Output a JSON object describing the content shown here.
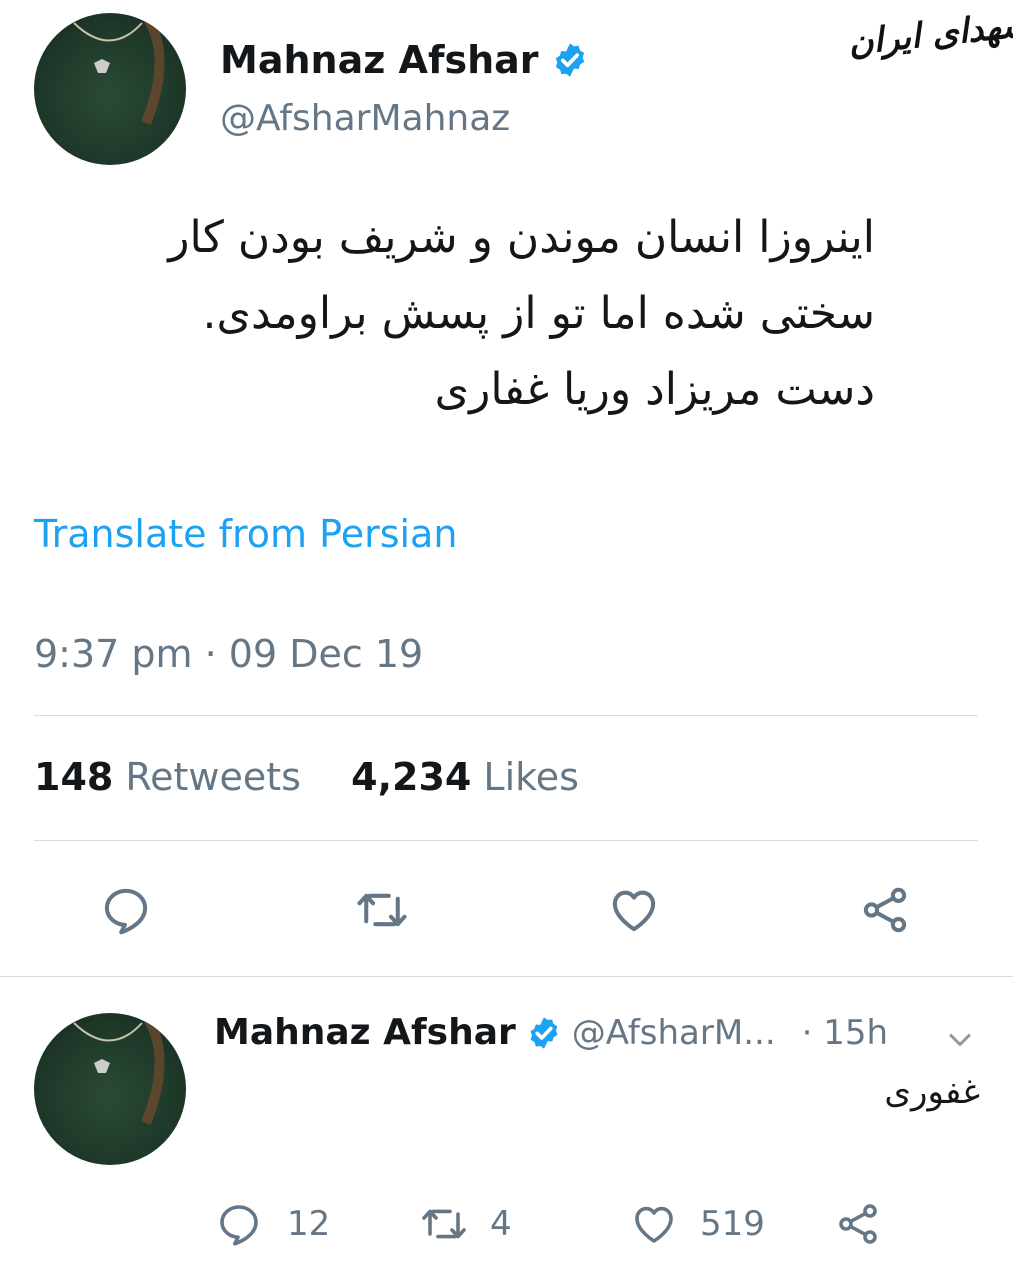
{
  "watermark": "شهدای ایران",
  "tweet": {
    "author_name": "Mahnaz Afshar",
    "author_handle": "@AfsharMahnaz",
    "text_lines": [
      "اینروزا انسان موندن و شریف بودن کار",
      "سختی شده اما تو از پسش براومدی.",
      "دست مریزاد وریا غفاری"
    ],
    "translate_label": "Translate from Persian",
    "timestamp": "9:37 pm · 09 Dec 19",
    "retweets_count": "148",
    "retweets_label": "Retweets",
    "likes_count": "4,234",
    "likes_label": "Likes",
    "colors": {
      "link": "#1da1f2",
      "verified": "#1da1f2",
      "muted": "#657786"
    },
    "icons": [
      "reply-icon",
      "retweet-icon",
      "like-icon",
      "share-icon"
    ]
  },
  "reply": {
    "author_name": "Mahnaz Afshar",
    "author_handle": "@AfsharM...",
    "time": "· 15h",
    "text": "غفوری",
    "reply_count": "12",
    "retweet_count": "4",
    "like_count": "519"
  }
}
